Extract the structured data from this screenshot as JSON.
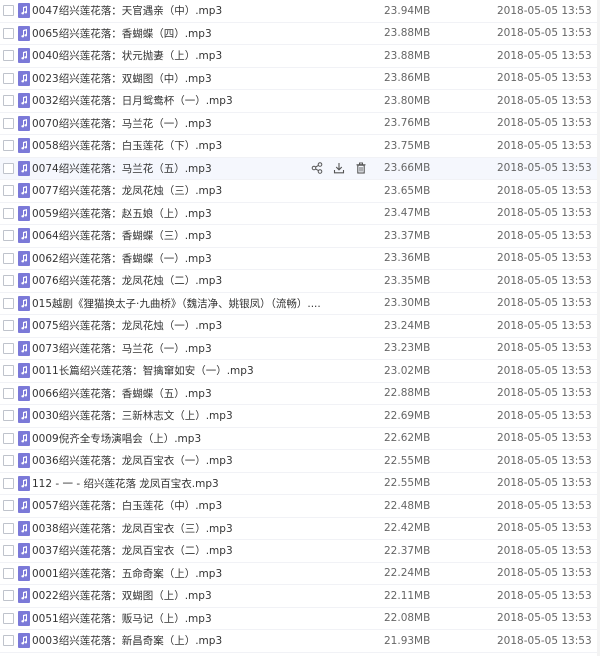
{
  "colors": {
    "icon_bg": "#7b79d8",
    "hover_row": "#f5f7fd",
    "text": "#333333",
    "meta_text": "#666666"
  },
  "hovered_index": 7,
  "row_actions": [
    {
      "name": "share-icon"
    },
    {
      "name": "download-icon"
    },
    {
      "name": "trash-icon"
    }
  ],
  "files": [
    {
      "name": "0047绍兴莲花落：天官遇亲（中）.mp3",
      "size": "23.94MB",
      "date": "2018-05-05 13:53"
    },
    {
      "name": "0065绍兴莲花落：香蝴蝶（四）.mp3",
      "size": "23.88MB",
      "date": "2018-05-05 13:53"
    },
    {
      "name": "0040绍兴莲花落：状元抛妻（上）.mp3",
      "size": "23.88MB",
      "date": "2018-05-05 13:53"
    },
    {
      "name": "0023绍兴莲花落：双蝴图（中）.mp3",
      "size": "23.86MB",
      "date": "2018-05-05 13:53"
    },
    {
      "name": "0032绍兴莲花落：日月鸳鸯杯（一）.mp3",
      "size": "23.80MB",
      "date": "2018-05-05 13:53"
    },
    {
      "name": "0070绍兴莲花落：马兰花（一）.mp3",
      "size": "23.76MB",
      "date": "2018-05-05 13:53"
    },
    {
      "name": "0058绍兴莲花落：白玉莲花（下）.mp3",
      "size": "23.75MB",
      "date": "2018-05-05 13:53"
    },
    {
      "name": "0074绍兴莲花落：马兰花（五）.mp3",
      "size": "23.66MB",
      "date": "2018-05-05 13:53"
    },
    {
      "name": "0077绍兴莲花落：龙凤花烛（三）.mp3",
      "size": "23.65MB",
      "date": "2018-05-05 13:53"
    },
    {
      "name": "0059绍兴莲花落：赵五娘（上）.mp3",
      "size": "23.47MB",
      "date": "2018-05-05 13:53"
    },
    {
      "name": "0064绍兴莲花落：香蝴蝶（三）.mp3",
      "size": "23.37MB",
      "date": "2018-05-05 13:53"
    },
    {
      "name": "0062绍兴莲花落：香蝴蝶（一）.mp3",
      "size": "23.36MB",
      "date": "2018-05-05 13:53"
    },
    {
      "name": "0076绍兴莲花落：龙凤花烛（二）.mp3",
      "size": "23.35MB",
      "date": "2018-05-05 13:53"
    },
    {
      "name": "015越剧《狸猫换太子·九曲桥》（魏洁净、姚银凤）（流畅）....",
      "size": "23.30MB",
      "date": "2018-05-05 13:53"
    },
    {
      "name": "0075绍兴莲花落：龙凤花烛（一）.mp3",
      "size": "23.24MB",
      "date": "2018-05-05 13:53"
    },
    {
      "name": "0073绍兴莲花落：马兰花（一）.mp3",
      "size": "23.23MB",
      "date": "2018-05-05 13:53"
    },
    {
      "name": "0011长篇绍兴莲花落：智擒窜如安（一）.mp3",
      "size": "23.02MB",
      "date": "2018-05-05 13:53"
    },
    {
      "name": "0066绍兴莲花落：香蝴蝶（五）.mp3",
      "size": "22.88MB",
      "date": "2018-05-05 13:53"
    },
    {
      "name": "0030绍兴莲花落：三新林志文（上）.mp3",
      "size": "22.69MB",
      "date": "2018-05-05 13:53"
    },
    {
      "name": "0009倪齐全专场演唱会（上）.mp3",
      "size": "22.62MB",
      "date": "2018-05-05 13:53"
    },
    {
      "name": "0036绍兴莲花落：龙凤百宝衣（一）.mp3",
      "size": "22.55MB",
      "date": "2018-05-05 13:53"
    },
    {
      "name": "112 - 一 - 绍兴莲花落 龙凤百宝衣.mp3",
      "size": "22.55MB",
      "date": "2018-05-05 13:53"
    },
    {
      "name": "0057绍兴莲花落：白玉莲花（中）.mp3",
      "size": "22.48MB",
      "date": "2018-05-05 13:53"
    },
    {
      "name": "0038绍兴莲花落：龙凤百宝衣（三）.mp3",
      "size": "22.42MB",
      "date": "2018-05-05 13:53"
    },
    {
      "name": "0037绍兴莲花落：龙凤百宝衣（二）.mp3",
      "size": "22.37MB",
      "date": "2018-05-05 13:53"
    },
    {
      "name": "0001绍兴莲花落：五命奇案（上）.mp3",
      "size": "22.24MB",
      "date": "2018-05-05 13:53"
    },
    {
      "name": "0022绍兴莲花落：双蝴图（上）.mp3",
      "size": "22.11MB",
      "date": "2018-05-05 13:53"
    },
    {
      "name": "0051绍兴莲花落：贩马记（上）.mp3",
      "size": "22.08MB",
      "date": "2018-05-05 13:53"
    },
    {
      "name": "0003绍兴莲花落：新昌奇案（上）.mp3",
      "size": "21.93MB",
      "date": "2018-05-05 13:53"
    }
  ]
}
